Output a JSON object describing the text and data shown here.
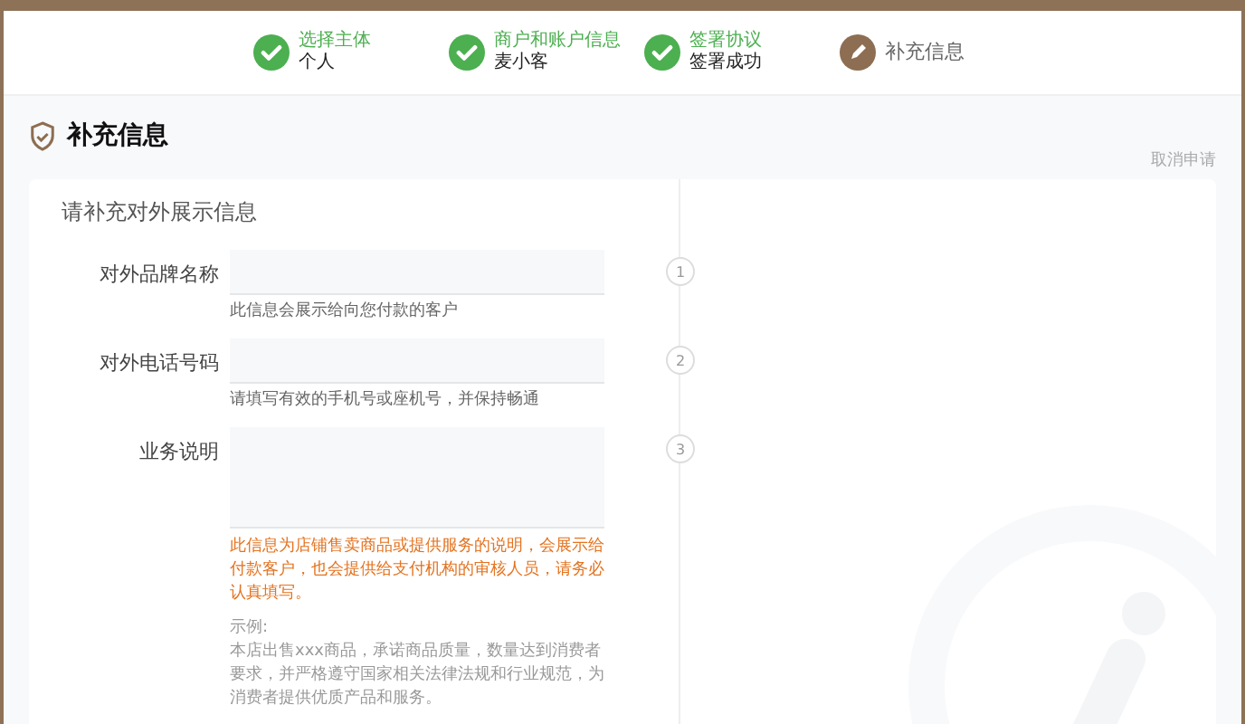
{
  "steps": [
    {
      "label": "选择主体",
      "value": "个人",
      "completed": true
    },
    {
      "label": "商户和账户信息",
      "value": "麦小客",
      "completed": true
    },
    {
      "label": "签署协议",
      "value": "签署成功",
      "completed": true
    },
    {
      "label": "补充信息",
      "completed": false
    }
  ],
  "page_title": "补充信息",
  "cancel_link": "取消申请",
  "section_title": "请补充对外展示信息",
  "fields": [
    {
      "label": "对外品牌名称",
      "kind": "input",
      "number": "1",
      "hint": "此信息会展示给向您付款的客户",
      "hint_warning": false
    },
    {
      "label": "对外电话号码",
      "kind": "input",
      "number": "2",
      "hint": "请填写有效的手机号或座机号，并保持畅通",
      "hint_warning": false
    },
    {
      "label": "业务说明",
      "kind": "textarea",
      "number": "3",
      "hint": "此信息为店铺售卖商品或提供服务的说明，会展示给付款客户，也会提供给支付机构的审核人员，请务必认真填写。",
      "hint_warning": true,
      "example_label": "示例:",
      "example": "本店出售xxx商品，承诺商品质量，数量达到消费者要求，并严格遵守国家相关法律法规和行业规范，为消费者提供优质产品和服务。"
    }
  ]
}
